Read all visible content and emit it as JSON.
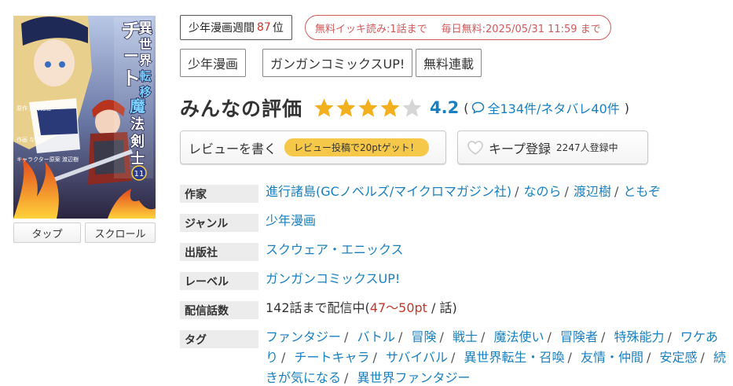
{
  "cover": {
    "title_chars": [
      "異",
      "世",
      "界",
      "転",
      "移",
      "し",
      "た",
      "の",
      "で"
    ],
    "title_big": [
      "チ",
      "ー",
      "ト"
    ],
    "title_mid": [
      "魔",
      "法",
      "剣",
      "士"
    ],
    "title_small": "を生かして",
    "title_small2": "やることにする",
    "volume": "11",
    "credits": [
      "原作 進行諸島",
      "作画 なのら",
      "キャラクター原案 渡辺樹"
    ]
  },
  "view_buttons": {
    "tap": "タップ",
    "scroll": "スクロール"
  },
  "rank": {
    "label": "少年漫画週間",
    "number": "87",
    "suffix": "位"
  },
  "free_info": {
    "read": "無料イッキ読み:1話まで",
    "daily": "毎日無料:2025/05/31 11:59 まで"
  },
  "category_tags": [
    "少年漫画",
    "ガンガンコミックスUP!",
    "無料連載"
  ],
  "rating": {
    "title": "みんなの評価",
    "stars": 4,
    "max_stars": 5,
    "score": "4.2",
    "open_paren": "(",
    "total": "全134件",
    "spoiler": "/ネタバレ40件",
    "close_paren": ")"
  },
  "actions": {
    "review_label": "レビューを書く",
    "review_promo": "レビュー投稿で20ptゲット！",
    "keep_label": "キープ登録",
    "keep_count": "2247人登録中"
  },
  "info": {
    "author_label": "作家",
    "authors": [
      "進行諸島(GCノベルズ/マイクロマガジン社)",
      "なのら",
      "渡辺樹",
      "ともぞ"
    ],
    "genre_label": "ジャンル",
    "genre": "少年漫画",
    "publisher_label": "出版社",
    "publisher": "スクウェア・エニックス",
    "label_label": "レーベル",
    "label": "ガンガンコミックスUP!",
    "episodes_label": "配信話数",
    "episodes_prefix": "142話まで配信中(",
    "episodes_price": "47〜50pt",
    "episodes_suffix": " / 話)",
    "tags_label": "タグ",
    "tags": [
      "ファンタジー",
      "バトル",
      "冒険",
      "戦士",
      "魔法使い",
      "冒険者",
      "特殊能力",
      "ワケあり",
      "チートキャラ",
      "サバイバル",
      "異世界転生・召喚",
      "友情・仲間",
      "安定感",
      "続きが気になる",
      "異世界ファンタジー"
    ]
  },
  "colors": {
    "link": "#1a7fbf",
    "rank_number": "#c0392b",
    "free_pill": "#d0595a",
    "star": "#f2b01e",
    "star_empty": "#d6d6d6",
    "promo": "#f5c84a"
  },
  "icons": [
    "comment-bubble-icon",
    "heart-icon",
    "star-icon"
  ]
}
